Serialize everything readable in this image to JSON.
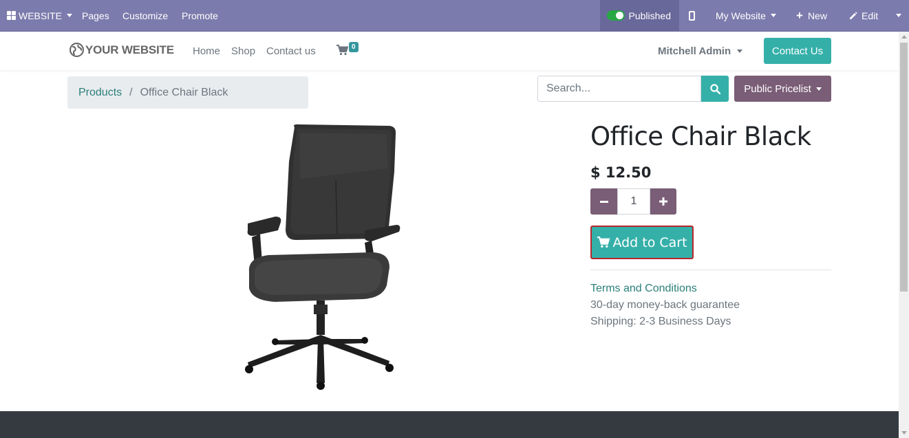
{
  "adminbar": {
    "app_menu": "WEBSITE",
    "pages": "Pages",
    "customize": "Customize",
    "promote": "Promote",
    "published": "Published",
    "website_selector": "My Website",
    "new": "New",
    "edit": "Edit"
  },
  "header": {
    "logo": "YOUR WEBSITE",
    "nav": [
      "Home",
      "Shop",
      "Contact us"
    ],
    "cart_count": "0",
    "user": "Mitchell Admin",
    "contact_button": "Contact Us"
  },
  "breadcrumb": {
    "parent": "Products",
    "separator": "/",
    "current": "Office Chair Black"
  },
  "search": {
    "placeholder": "Search...",
    "pricelist": "Public Pricelist"
  },
  "product": {
    "name": "Office Chair Black",
    "price": "$ 12.50",
    "quantity": "1",
    "add_to_cart": "Add to Cart",
    "terms": "Terms and Conditions",
    "guarantee": "30-day money-back guarantee",
    "shipping": "Shipping: 2-3 Business Days"
  },
  "colors": {
    "adminbar": "#7c7bad",
    "primary": "#35b0a9",
    "secondary": "#7a5d76",
    "footer": "#343a40"
  }
}
